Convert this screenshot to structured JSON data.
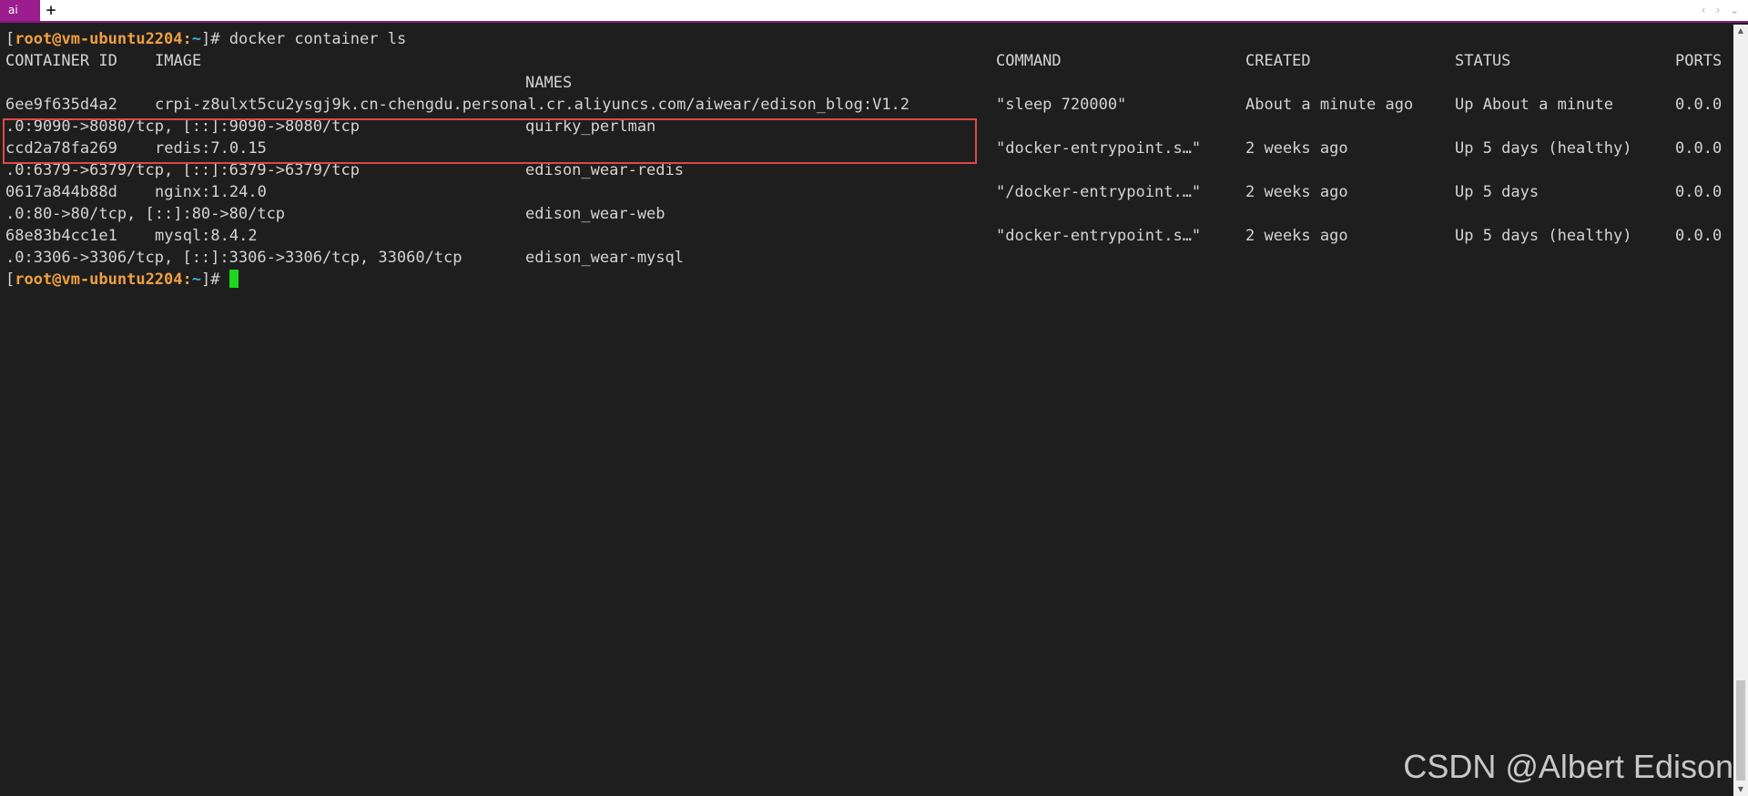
{
  "tabbar": {
    "tab_label": "ai",
    "add_label": "+",
    "nav_prev": "‹",
    "nav_next": "›",
    "nav_menu": "⌄"
  },
  "terminal": {
    "prompt": {
      "open": "[",
      "user": "root",
      "at": "@",
      "host": "vm-ubuntu2204",
      "colon": ":",
      "dir": "~",
      "close": "]#"
    },
    "command": " docker container ls",
    "headers": {
      "container_id": "CONTAINER ID",
      "image": "IMAGE",
      "command": "COMMAND",
      "created": "CREATED",
      "status": "STATUS",
      "ports": "PORTS",
      "names": "NAMES"
    },
    "containers": [
      {
        "id": "6ee9f635d4a2",
        "image": "crpi-z8ulxt5cu2ysgj9k.cn-chengdu.personal.cr.aliyuncs.com/aiwear/edison_blog:V1.2",
        "command": "\"sleep 720000\"",
        "created": "About a minute ago",
        "status": "Up About a minute",
        "ports_head": "0.0.0",
        "ports_tail": ".0:9090->8080/tcp, [::]:9090->8080/tcp",
        "name": "quirky_perlman"
      },
      {
        "id": "ccd2a78fa269",
        "image": "redis:7.0.15",
        "command": "\"docker-entrypoint.s…\"",
        "created": "2 weeks ago",
        "status": "Up 5 days (healthy)",
        "ports_head": "0.0.0",
        "ports_tail": ".0:6379->6379/tcp, [::]:6379->6379/tcp",
        "name": "edison_wear-redis"
      },
      {
        "id": "0617a844b88d",
        "image": "nginx:1.24.0",
        "command": "\"/docker-entrypoint.…\"",
        "created": "2 weeks ago",
        "status": "Up 5 days",
        "ports_head": "0.0.0",
        "ports_tail": ".0:80->80/tcp, [::]:80->80/tcp",
        "name": "edison_wear-web"
      },
      {
        "id": "68e83b4cc1e1",
        "image": "mysql:8.4.2",
        "command": "\"docker-entrypoint.s…\"",
        "created": "2 weeks ago",
        "status": "Up 5 days (healthy)",
        "ports_head": "0.0.0",
        "ports_tail": ".0:3306->3306/tcp, [::]:3306->3306/tcp, 33060/tcp",
        "name": "edison_wear-mysql"
      }
    ]
  },
  "scrollbar": {
    "up_arrow": "▲",
    "down_arrow": "▼"
  },
  "watermark": "CSDN @Albert Edison",
  "colors": {
    "background": "#1e1e1e",
    "text": "#d4d4d4",
    "prompt_user_host": "#f0a040",
    "prompt_dir": "#3ab0e0",
    "cursor": "#1cd81c",
    "highlight_border": "#e04848",
    "tab_accent": "#9b1d8e"
  }
}
